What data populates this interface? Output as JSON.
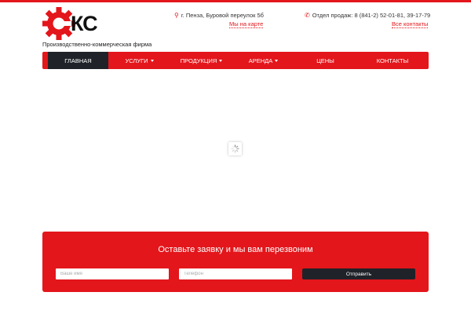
{
  "brand": {
    "logo_text": "КС",
    "tagline": "Производственно-коммерческая фирма",
    "accent": "#e3161b",
    "dark": "#1f2329"
  },
  "header": {
    "address": "г. Пенза, Буровой переулок 5б",
    "address_icon": "map-pin-icon",
    "map_link": "Мы на карте",
    "phone": "Отдел продаж: 8 (841-2) 52-01-81, 39-17-79",
    "phone_icon": "phone-icon",
    "contacts_link": "Все контакты"
  },
  "nav": {
    "items": [
      {
        "label": "Главная",
        "active": true,
        "dropdown": false
      },
      {
        "label": "Услуги",
        "active": false,
        "dropdown": true
      },
      {
        "label": "Продукция",
        "active": false,
        "dropdown": true
      },
      {
        "label": "Аренда",
        "active": false,
        "dropdown": true
      },
      {
        "label": "Цены",
        "active": false,
        "dropdown": false
      },
      {
        "label": "Контакты",
        "active": false,
        "dropdown": false
      }
    ]
  },
  "callback": {
    "title": "Оставьте заявку и мы вам перезвоним",
    "name_placeholder": "Ваше имя",
    "phone_placeholder": "Телефон",
    "submit_label": "Отправить"
  }
}
